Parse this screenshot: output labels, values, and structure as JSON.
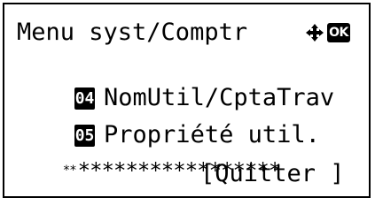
{
  "screen": {
    "title": "Menu syst/Comptr",
    "nav_icon": "dpad-arrows-icon",
    "ok_label": "OK"
  },
  "menu": {
    "items": [
      {
        "number": "04",
        "label": "NomUtil/CptaTrav"
      },
      {
        "number": "05",
        "label": "Propriété util."
      }
    ]
  },
  "masked": {
    "prefix": "**",
    "stars": "*****************"
  },
  "softkey": {
    "quit_label": "[Quitter ]"
  }
}
